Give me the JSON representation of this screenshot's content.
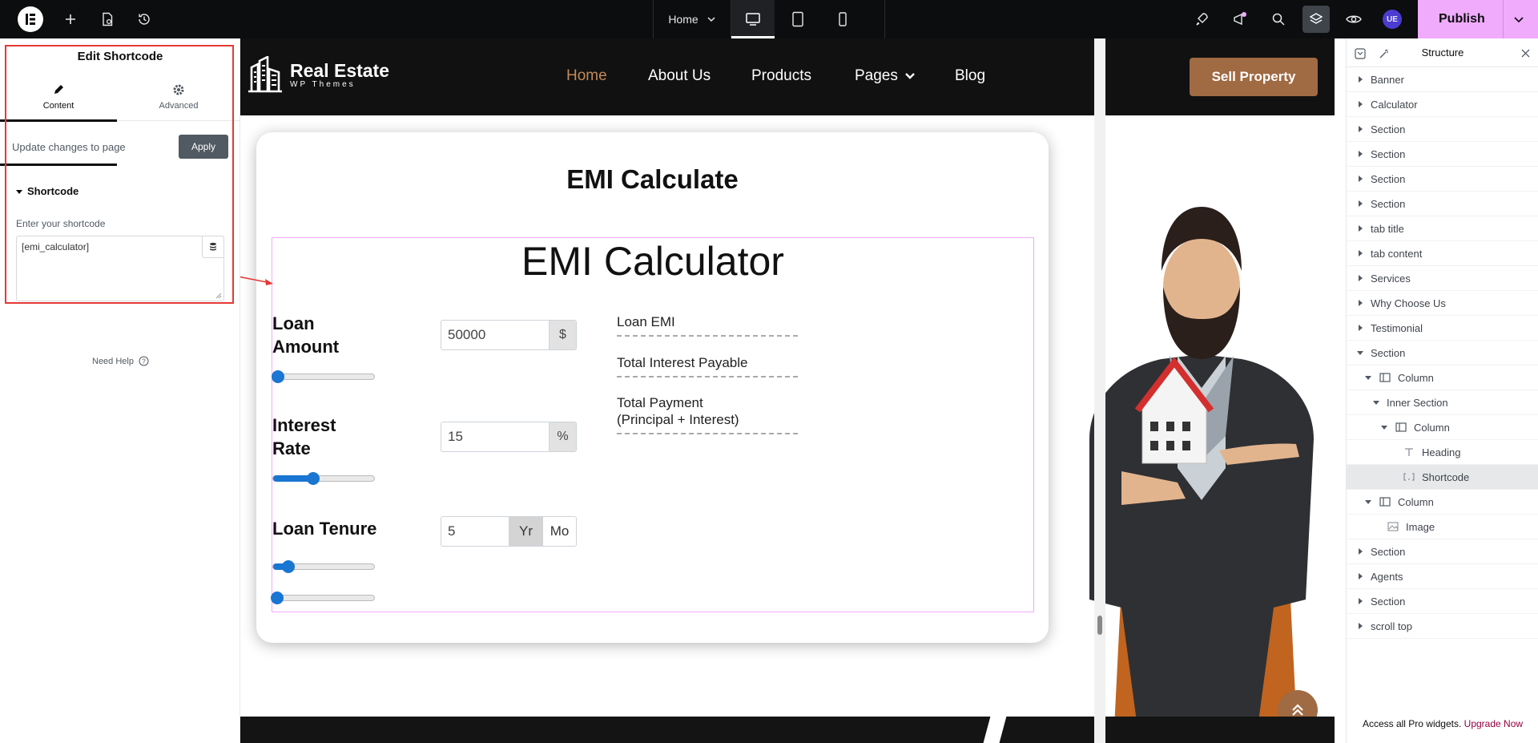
{
  "topbar": {
    "page_name": "Home",
    "publish_label": "Publish",
    "user_initials": "UE"
  },
  "panel": {
    "title": "Edit Shortcode",
    "tabs": [
      {
        "label": "Content",
        "icon": "pencil-icon",
        "active": true
      },
      {
        "label": "Advanced",
        "icon": "gear-icon",
        "active": false
      }
    ],
    "update_label": "Update changes to page",
    "apply_label": "Apply",
    "section_title": "Shortcode",
    "field_label": "Enter your shortcode",
    "shortcode_value": "[emi_calculator]",
    "need_help": "Need Help"
  },
  "site": {
    "logo_title": "Real Estate",
    "logo_sub": "WP Themes",
    "nav": [
      "Home",
      "About Us",
      "Products",
      "Pages",
      "Blog"
    ],
    "active_nav": "Home",
    "cta": "Sell Property"
  },
  "calculator": {
    "heading": "EMI Calculate",
    "title": "EMI Calculator",
    "fields": [
      {
        "label_line1": "Loan",
        "label_line2": "Amount",
        "value": "50000",
        "unit": "$",
        "slider_fraction": 0.05
      },
      {
        "label_line1": "Interest",
        "label_line2": "Rate",
        "value": "15",
        "unit": "%",
        "slider_fraction": 0.4
      },
      {
        "label_line1": "Loan Tenure",
        "label_line2": "",
        "value": "5",
        "units": [
          "Yr",
          "Mo"
        ],
        "selected_unit": "Yr",
        "slider_fraction": 0.15,
        "slider2_fraction": 0.04
      }
    ],
    "results": [
      {
        "line1": "Loan EMI",
        "line2": ""
      },
      {
        "line1": "Total Interest Payable",
        "line2": ""
      },
      {
        "line1": "Total Payment",
        "line2": "(Principal + Interest)"
      }
    ]
  },
  "structure": {
    "title": "Structure",
    "items": [
      {
        "label": "Banner",
        "depth": 0,
        "type": "section",
        "expanded": false
      },
      {
        "label": "Calculator",
        "depth": 0,
        "type": "section",
        "expanded": false
      },
      {
        "label": "Section",
        "depth": 0,
        "type": "section",
        "expanded": false
      },
      {
        "label": "Section",
        "depth": 0,
        "type": "section",
        "expanded": false
      },
      {
        "label": "Section",
        "depth": 0,
        "type": "section",
        "expanded": false
      },
      {
        "label": "Section",
        "depth": 0,
        "type": "section",
        "expanded": false
      },
      {
        "label": "tab title",
        "depth": 0,
        "type": "section",
        "expanded": false
      },
      {
        "label": "tab content",
        "depth": 0,
        "type": "section",
        "expanded": false
      },
      {
        "label": "Services",
        "depth": 0,
        "type": "section",
        "expanded": false
      },
      {
        "label": "Why Choose Us",
        "depth": 0,
        "type": "section",
        "expanded": false
      },
      {
        "label": "Testimonial",
        "depth": 0,
        "type": "section",
        "expanded": false
      },
      {
        "label": "Section",
        "depth": 0,
        "type": "section",
        "expanded": true
      },
      {
        "label": "Column",
        "depth": 1,
        "type": "column",
        "expanded": true
      },
      {
        "label": "Inner Section",
        "depth": 2,
        "type": "inner",
        "expanded": true
      },
      {
        "label": "Column",
        "depth": 3,
        "type": "column",
        "expanded": true
      },
      {
        "label": "Heading",
        "depth": 4,
        "type": "heading",
        "expanded": null
      },
      {
        "label": "Shortcode",
        "depth": 4,
        "type": "shortcode",
        "expanded": null,
        "selected": true
      },
      {
        "label": "Column",
        "depth": 1,
        "type": "column",
        "expanded": true
      },
      {
        "label": "Image",
        "depth": 2,
        "type": "image",
        "expanded": null
      },
      {
        "label": "Section",
        "depth": 0,
        "type": "section",
        "expanded": false
      },
      {
        "label": "Agents",
        "depth": 0,
        "type": "section",
        "expanded": false
      },
      {
        "label": "Section",
        "depth": 0,
        "type": "section",
        "expanded": false
      },
      {
        "label": "scroll top",
        "depth": 0,
        "type": "section",
        "expanded": false
      }
    ],
    "footer_text": "Access all Pro widgets.",
    "footer_link": "Upgrade Now"
  },
  "colors": {
    "accent": "#f0abfc",
    "brand_brown": "#a06a43",
    "highlight_red": "#e53935",
    "slider_blue": "#1976d2"
  }
}
